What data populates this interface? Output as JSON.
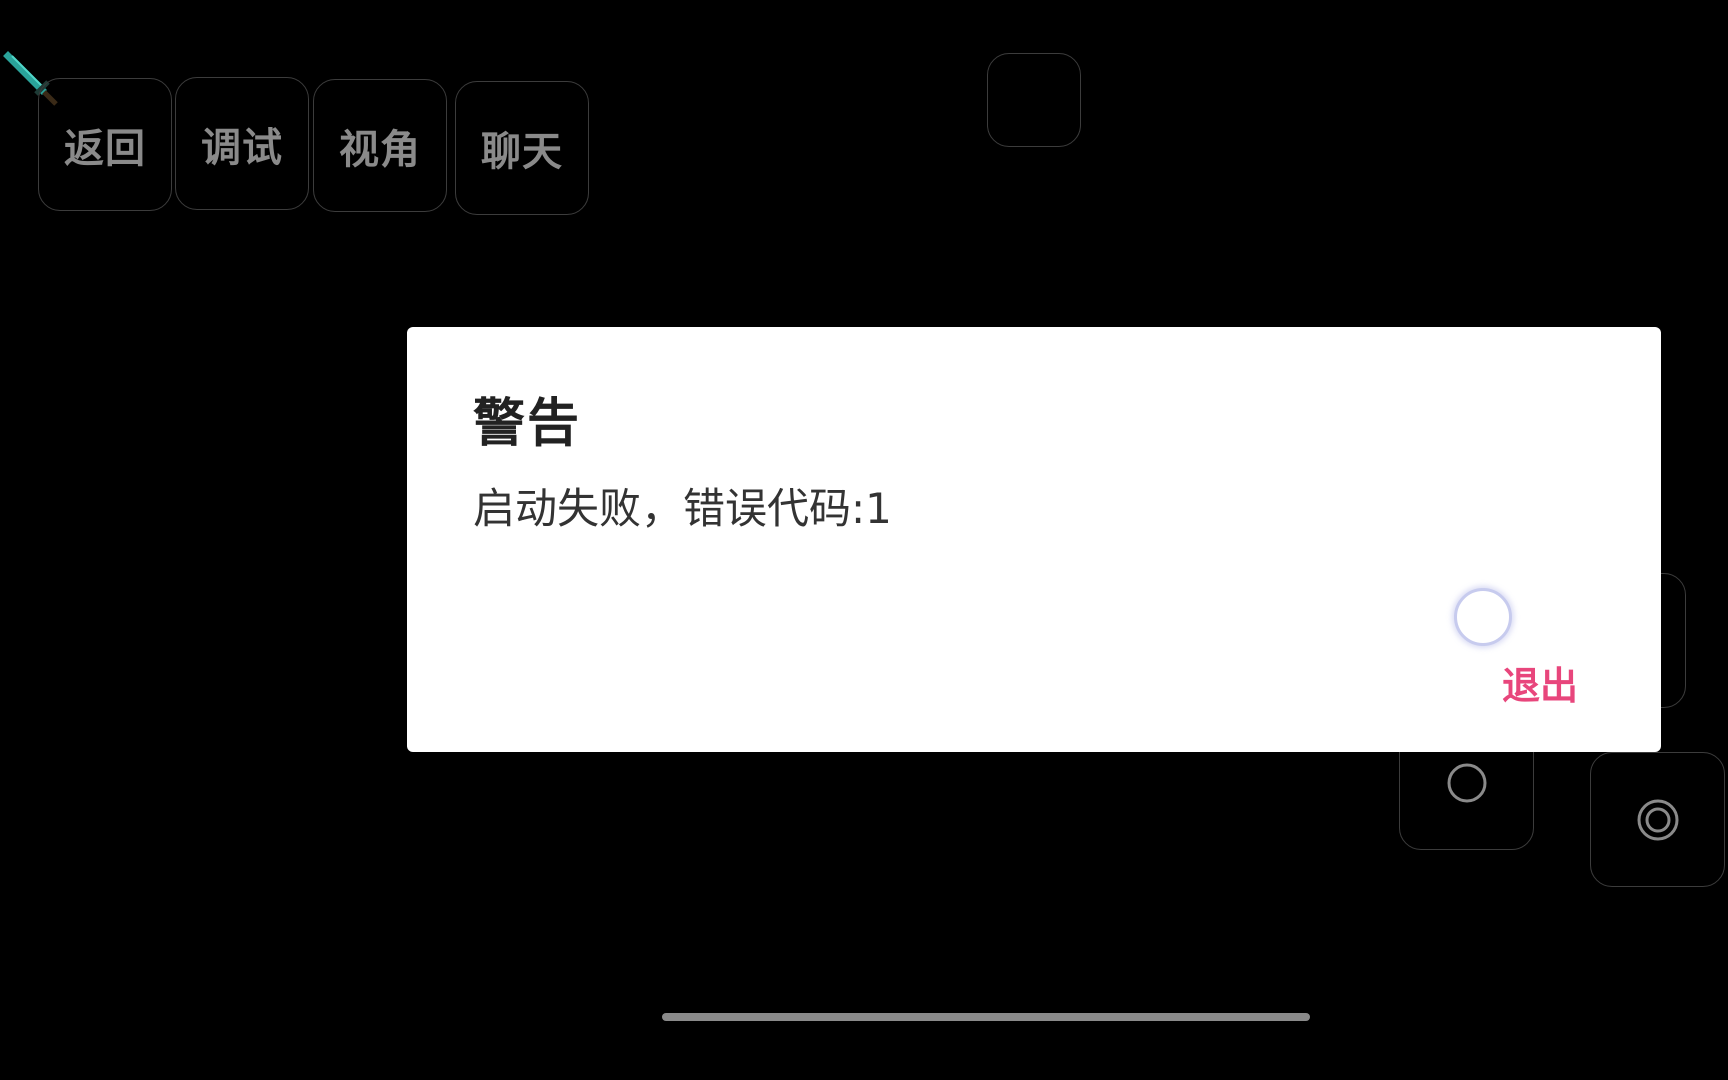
{
  "top_buttons": {
    "back": "返回",
    "debug": "调试",
    "view": "视角",
    "chat": "聊天"
  },
  "hotbar_item_icon": "diamond-sword-icon",
  "dialog": {
    "title": "警告",
    "message": "启动失败，错误代码:1",
    "exit_label": "退出",
    "exit_color": "#e8467c"
  },
  "controls": {
    "inventory_icon": "empty-slot",
    "jump_icon": "circle-icon",
    "attack_icon": "target-icon"
  }
}
